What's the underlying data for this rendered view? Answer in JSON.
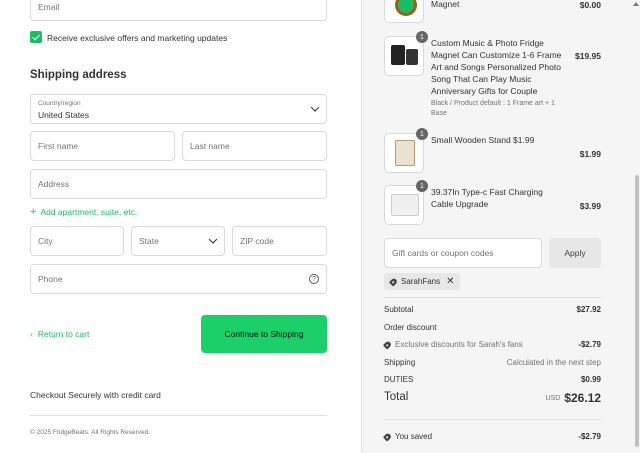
{
  "contact": {
    "email_placeholder": "Email",
    "offers_label": "Receive exclusive offers and marketing updates"
  },
  "shipping": {
    "heading": "Shipping address",
    "country_label": "Country/region",
    "country_value": "United States",
    "first_name": "First name",
    "last_name": "Last name",
    "address": "Address",
    "add_apartment": "Add apartment, suite, etc.",
    "city": "City",
    "state": "State",
    "zip": "ZIP code",
    "phone": "Phone"
  },
  "actions": {
    "return_label": "Return to cart",
    "continue_label": "Continue to Shipping"
  },
  "footer": {
    "secure_text": "Checkout Securely with credit card",
    "copyright": "© 2025 FridgeBeats. All Rights Reserved."
  },
  "cart": {
    "items": [
      {
        "title": "Magnet",
        "price": "$0.00",
        "qty": "",
        "variant": ""
      },
      {
        "title": "Custom Music & Photo Fridge Magnet Can Customize 1-6 Frame Art and Songs Personalized Photo Song That Can Play Music Anniversary Gifts for Couple",
        "price": "$19.95",
        "qty": "1",
        "variant": "Black / Product default : 1 Frame art + 1 Base"
      },
      {
        "title": "Small Wooden Stand $1.99",
        "price": "$1.99",
        "qty": "1",
        "variant": ""
      },
      {
        "title": "39.37In Type-c Fast Charging Cable Upgrade",
        "price": "$3.99",
        "qty": "1",
        "variant": ""
      }
    ],
    "coupon_placeholder": "Gift cards or coupon codes",
    "apply_label": "Apply",
    "applied_code": "SarahFans"
  },
  "summary": {
    "subtotal_label": "Subtotal",
    "subtotal_value": "$27.92",
    "discount_label": "Order discount",
    "discount_detail": "Exclusive discounts for Sarah's fans",
    "discount_value": "-$2.79",
    "shipping_label": "Shipping",
    "shipping_value": "Calculated in the next step",
    "duties_label": "DUTIES",
    "duties_value": "$0.99",
    "total_label": "Total",
    "total_currency": "USD",
    "total_value": "$26.12",
    "saved_label": "You saved",
    "saved_value": "-$2.79"
  },
  "colors": {
    "accent": "#1bcf69",
    "link": "#1bbd64"
  }
}
